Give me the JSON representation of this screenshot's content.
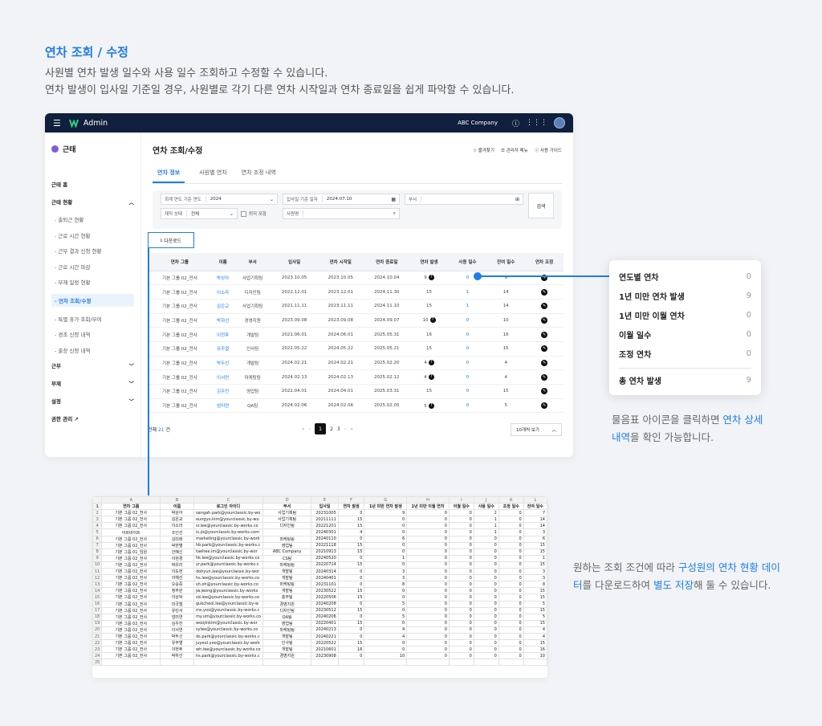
{
  "intro": {
    "title": "연차 조회 / 수정",
    "line1": "사원별 연차 발생 일수와 사용 일수 조회하고 수정할 수 있습니다.",
    "line2": "연차 발생이 입사일 기준일 경우, 사원별로 각기 다른 연차 시작일과 연차 종료일을 쉽게 파악할 수 있습니다."
  },
  "topbar": {
    "title": "Admin",
    "company": "ABC Company"
  },
  "sidebar": {
    "module": "근태",
    "home": "근태 홈",
    "status": "근태 현황",
    "items": [
      "출퇴근 현황",
      "근로 시간 현황",
      "근무 결과 신청 현황",
      "근로 시간 마감",
      "부재 일정 현황",
      "연차 조회/수정",
      "특별 휴가 조회/부여",
      "경조 신청 내역",
      "출장 신청 내역"
    ],
    "work": "근무",
    "absence": "부재",
    "settings": "설정",
    "admin": "권한 관리"
  },
  "main": {
    "title": "연차 조회/수정",
    "actions": [
      "즐겨찾기",
      "관리자 메뉴",
      "사용 가이드"
    ],
    "tabs": [
      "연차 정보",
      "사원별 연차",
      "연차 조정 내역"
    ]
  },
  "filters": {
    "year_label": "회계 연도 기준 연도",
    "year_value": "2024",
    "date_label": "입사일 기준 일자",
    "date_value": "2024.07.10",
    "dept_label": "부서",
    "status_label": "재직 상태",
    "status_value": "전체",
    "retired_label": "퇴직 포함",
    "name_label": "사원명",
    "search_label": "검색"
  },
  "download_label": "다운로드",
  "table": {
    "headers": [
      "연차 그룹",
      "이름",
      "부서",
      "입사일",
      "연차 시작일",
      "연차 종료일",
      "연차 발생",
      "사용 일수",
      "잔여 일수",
      "연차 조정"
    ],
    "rows": [
      {
        "g": "기본 그룹 02_전사",
        "n": "박상아",
        "d": "사업기획팀",
        "j": "2023.10.05",
        "s": "2023.10.05",
        "e": "2024.10.04",
        "o": "9",
        "q": true,
        "u": "0",
        "r": "9"
      },
      {
        "g": "기본 그룹 02_전사",
        "n": "이소라",
        "d": "디자인팀",
        "j": "2022.12.01",
        "s": "2023.12.01",
        "e": "2024.11.30",
        "o": "15",
        "q": false,
        "u": "1",
        "r": "14"
      },
      {
        "g": "기본 그룹 02_전사",
        "n": "김은교",
        "d": "사업기획팀",
        "j": "2021.11.11",
        "s": "2023.11.11",
        "e": "2024.11.10",
        "o": "15",
        "q": false,
        "u": "1",
        "r": "14"
      },
      {
        "g": "기본 그룹 02_전사",
        "n": "박하선",
        "d": "경영지원",
        "j": "2023.09.08",
        "s": "2023.09.08",
        "e": "2024.09.07",
        "o": "10",
        "q": true,
        "u": "0",
        "r": "10"
      },
      {
        "g": "기본 그룹 02_전사",
        "n": "이현후",
        "d": "개발팀",
        "j": "2021.06.01",
        "s": "2024.06.01",
        "e": "2025.05.31",
        "o": "16",
        "q": false,
        "u": "0",
        "r": "16"
      },
      {
        "g": "기본 그룹 02_전사",
        "n": "유주열",
        "d": "인사팀",
        "j": "2022.05.22",
        "s": "2024.05.22",
        "e": "2025.05.21",
        "o": "15",
        "q": false,
        "u": "0",
        "r": "15"
      },
      {
        "g": "기본 그룹 02_전사",
        "n": "박두신",
        "d": "개발팀",
        "j": "2024.02.21",
        "s": "2024.02.21",
        "e": "2025.02.20",
        "o": "4",
        "q": true,
        "u": "0",
        "r": "4"
      },
      {
        "g": "기본 그룹 02_전사",
        "n": "이서연",
        "d": "마케팅팀",
        "j": "2024.02.13",
        "s": "2024.02.13",
        "e": "2025.02.12",
        "o": "4",
        "q": true,
        "u": "0",
        "r": "4"
      },
      {
        "g": "기본 그룹 02_전사",
        "n": "김우진",
        "d": "영업팀",
        "j": "2022.04.01",
        "s": "2024.04.01",
        "e": "2025.03.31",
        "o": "15",
        "q": false,
        "u": "0",
        "r": "15"
      },
      {
        "g": "기본 그룹 02_전사",
        "n": "엄미연",
        "d": "QA팀",
        "j": "2024.02.06",
        "s": "2024.02.06",
        "e": "2025.02.05",
        "o": "5",
        "q": true,
        "u": "0",
        "r": "5"
      }
    ]
  },
  "footer": {
    "total_label": "전체",
    "total_count": "21",
    "total_unit": "건",
    "pages": [
      "1",
      "2",
      "3"
    ],
    "page_size": "10개씩 보기"
  },
  "popup": {
    "rows": [
      {
        "label": "연도별 연차",
        "value": "0"
      },
      {
        "label": "1년 미만 연차 발생",
        "value": "9"
      },
      {
        "label": "1년 미만 이월 연차",
        "value": "0"
      },
      {
        "label": "이월 일수",
        "value": "0"
      },
      {
        "label": "조정 연차",
        "value": "0"
      }
    ],
    "total_label": "총 연차 발생",
    "total_value": "9"
  },
  "popup_caption": {
    "a": "물음표 아이콘을 클릭하면 ",
    "b": "연차 상세 내역",
    "c": "을 확인 가능합니다."
  },
  "sheet_caption": {
    "a": "원하는 조회 조건에 따라 ",
    "b": "구성원의 연차 현황 데이터",
    "c": "를 다운로드하여 ",
    "d": "별도 저장",
    "e": "해 둘 수 있습니다."
  },
  "sheet": {
    "cols": [
      "A",
      "B",
      "C",
      "D",
      "E",
      "F",
      "G",
      "H",
      "I",
      "J",
      "K",
      "L"
    ],
    "headers": [
      "연차 그룹",
      "이름",
      "로그인 아이디",
      "부서",
      "입사일",
      "연차 발생",
      "1년 미만 연차 발생",
      "1년 미만 이월 연차",
      "이월 일수",
      "사용 일수",
      "조정 일수",
      "잔여 일수"
    ],
    "rows": [
      [
        "기본 그룹 02_전사",
        "박상아",
        "sangah.park@yourclassic.by-wo",
        "사업기획팀",
        "20231005",
        "0",
        "9",
        "0",
        "0",
        "2",
        "0",
        "7"
      ],
      [
        "기본 그룹 02_전사",
        "김은교",
        "eungyo.kim@yourclassic.by-wo",
        "사업기획팀",
        "20211111",
        "15",
        "0",
        "0",
        "0",
        "1",
        "0",
        "14"
      ],
      [
        "기본 그룹 02_전사",
        "이소라",
        "sr.lee@yourclassic.by-works.co",
        "디자인팀",
        "20221201",
        "15",
        "0",
        "0",
        "0",
        "1",
        "0",
        "14"
      ],
      [
        "아르바이트",
        "조인선",
        "is.jo@yourclassic.by-works.com",
        "",
        "20240301",
        "4",
        "0",
        "0",
        "0",
        "1",
        "0",
        "3"
      ],
      [
        "기본 그룹 02_전사",
        "김미래",
        "marketing@yourclassic.by-work",
        "마케팅팀",
        "20240110",
        "0",
        "6",
        "0",
        "0",
        "0",
        "0",
        "6"
      ],
      [
        "기본 그룹 02_전사",
        "박한별",
        "hb.park@yourclassic.by-works.c",
        "영업팀",
        "20221118",
        "15",
        "0",
        "0",
        "0",
        "0",
        "0",
        "15"
      ],
      [
        "기본 그룹 01_임원",
        "안혜신",
        "taehee.im@yourclassic.by-wor",
        "ABC Company",
        "20210913",
        "15",
        "0",
        "0",
        "0",
        "0",
        "0",
        "15"
      ],
      [
        "기본 그룹 02_전사",
        "이현경",
        "hk.lee@yourclassic.by-works.co",
        "CS팀",
        "20240520",
        "0",
        "1",
        "0",
        "0",
        "0",
        "0",
        "1"
      ],
      [
        "기본 그룹 02_전사",
        "박유리",
        "yr.park@yourclassic.by-works.c",
        "마케팅팀",
        "20220714",
        "15",
        "0",
        "0",
        "0",
        "0",
        "0",
        "15"
      ],
      [
        "기본 그룹 02_전사",
        "이도현",
        "dohyun.lee@yourclassic.by-wor",
        "개발팀",
        "20240314",
        "0",
        "3",
        "0",
        "0",
        "0",
        "0",
        "3"
      ],
      [
        "기본 그룹 02_전사",
        "이혜선",
        "hs.lee@yourclassic.by-works.co",
        "개발팀",
        "20240401",
        "0",
        "3",
        "0",
        "0",
        "0",
        "0",
        "3"
      ],
      [
        "기본 그룹 02_전사",
        "오승중",
        "sh.oh@yourclassic.by-works.co",
        "마케팅팀",
        "20231101",
        "0",
        "8",
        "0",
        "0",
        "0",
        "0",
        "8"
      ],
      [
        "기본 그룹 02_전사",
        "정주원",
        "jw.jeong@yourclassic.by-works",
        "개발팀",
        "20230522",
        "15",
        "0",
        "0",
        "0",
        "0",
        "0",
        "15"
      ],
      [
        "기본 그룹 02_전사",
        "이상덕",
        "sd.lee@yourclassic.by-works.co",
        "총무팀",
        "20220506",
        "15",
        "0",
        "0",
        "0",
        "0",
        "0",
        "15"
      ],
      [
        "기본 그룹 02_전사",
        "미국철",
        "gukcheol.lee@yourclassic.by-w",
        "경영지원",
        "20240208",
        "0",
        "5",
        "0",
        "0",
        "0",
        "0",
        "5"
      ],
      [
        "기본 그룹 02_전사",
        "유민서",
        "ms.yoo@yourclassic.by-works.c",
        "디자인팀",
        "20230512",
        "15",
        "0",
        "0",
        "0",
        "0",
        "0",
        "15"
      ],
      [
        "기본 그룹 02_전사",
        "엄미연",
        "my.um@yourclassic.by-works.co",
        "QA팀",
        "20240206",
        "0",
        "5",
        "0",
        "0",
        "0",
        "0",
        "5"
      ],
      [
        "기본 그룹 02_전사",
        "김우진",
        "woojinkim@yourclassic.by-wor",
        "영업팀",
        "20220401",
        "15",
        "0",
        "0",
        "0",
        "0",
        "0",
        "15"
      ],
      [
        "기본 그룹 02_전사",
        "이서연",
        "sylee@yourclassic.by-works.co",
        "마케팅팀",
        "20240213",
        "0",
        "4",
        "0",
        "0",
        "0",
        "0",
        "4"
      ],
      [
        "기본 그룹 02_전사",
        "박두신",
        "ds.park@yourclassic.by-works.c",
        "개발팀",
        "20240221",
        "0",
        "4",
        "0",
        "0",
        "0",
        "0",
        "4"
      ],
      [
        "기본 그룹 02_전사",
        "유주열",
        "juyeol.yoo@yourclassic.by-work",
        "인사팀",
        "20220522",
        "15",
        "0",
        "0",
        "0",
        "0",
        "0",
        "15"
      ],
      [
        "기본 그룹 02_전사",
        "이현후",
        "wh.lee@yourclassic.by-works.co",
        "개발팀",
        "20210601",
        "16",
        "0",
        "0",
        "0",
        "0",
        "0",
        "16"
      ],
      [
        "기본 그룹 02_전사",
        "박하선",
        "hs.park@yourclassic.by-works.c",
        "경영지원",
        "20230908",
        "0",
        "10",
        "0",
        "0",
        "0",
        "0",
        "10"
      ]
    ]
  }
}
